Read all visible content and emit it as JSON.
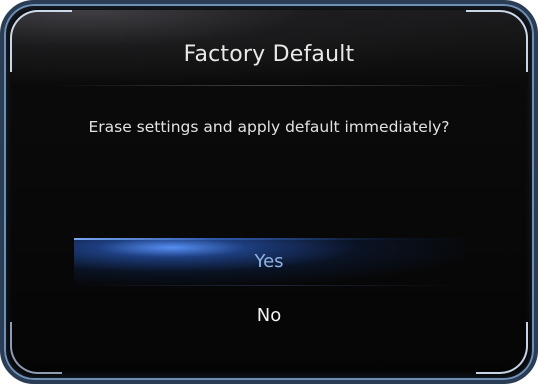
{
  "dialog": {
    "title": "Factory Default",
    "message": "Erase settings and apply default immediately?",
    "options": [
      {
        "label": "Yes",
        "selected": true
      },
      {
        "label": "No",
        "selected": false
      }
    ]
  },
  "colors": {
    "frame_border": "#2a3d55",
    "background": "#050505",
    "highlight": "#2f6ad6",
    "selected_text": "#8fb2e3",
    "text": "#e9e9e9"
  }
}
